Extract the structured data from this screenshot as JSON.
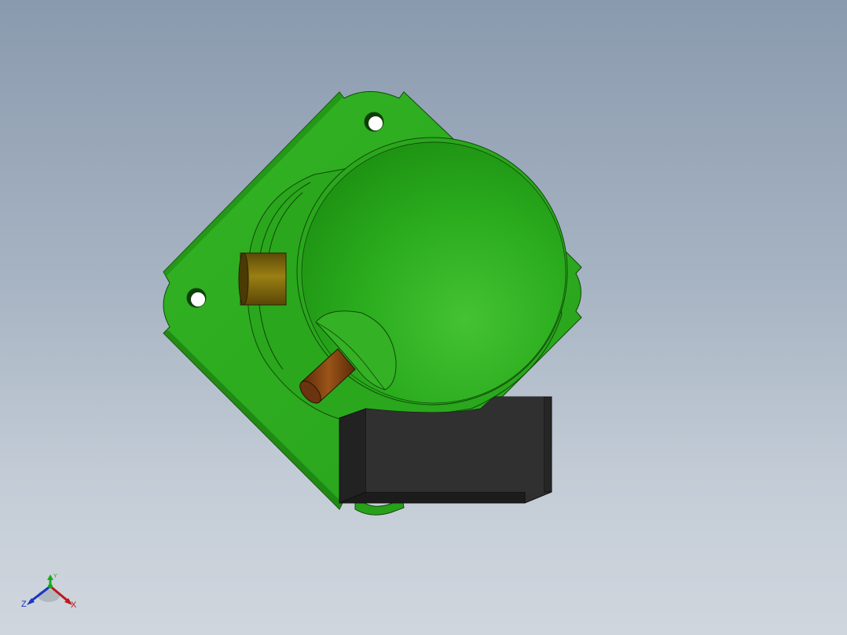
{
  "viewport": {
    "background_top": "#8a9aae",
    "background_bottom": "#d0d6de"
  },
  "model": {
    "parts": [
      "mounting-plate",
      "compressor-dome",
      "suction-pipe",
      "discharge-pipe",
      "terminal-box"
    ],
    "colors": {
      "plate": "#2ea81f",
      "dome": "#27a81a",
      "dome_highlight": "#45c234",
      "pipe_brass": "#8a7010",
      "pipe_copper": "#8a4a14",
      "terminal_box": "#2f2f2f"
    }
  },
  "triad": {
    "x_label": "X",
    "y_label": "Y",
    "z_label": "Z",
    "x_color": "#c0161b",
    "y_color": "#1aa81a",
    "z_color": "#1a36c0"
  }
}
